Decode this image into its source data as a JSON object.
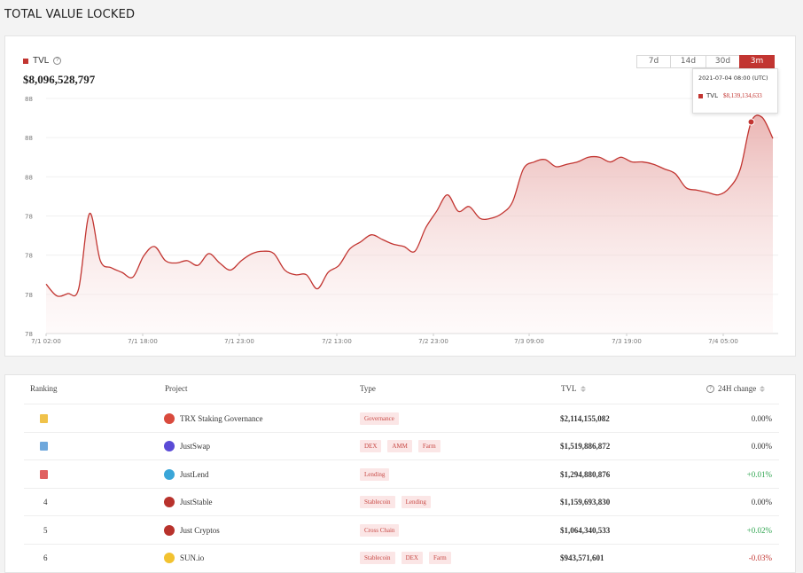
{
  "page_title": "TOTAL VALUE LOCKED",
  "chart_card": {
    "legend_label": "TVL",
    "current_value": "$8,096,528,797",
    "range_tabs": [
      "7d",
      "14d",
      "30d",
      "3m"
    ],
    "active_tab": "3m",
    "tooltip": {
      "date": "2021-07-04 08:00 (UTC)",
      "series_label": "TVL",
      "value": "$8,139,134,633"
    }
  },
  "chart_data": {
    "type": "area",
    "title": "",
    "xlabel": "",
    "ylabel": "",
    "y_tick_labels": [
      "88",
      "88",
      "88",
      "78",
      "78",
      "78",
      "78"
    ],
    "x_tick_labels": [
      "7/1 02:00",
      "7/1 18:00",
      "7/1 23:00",
      "7/2 13:00",
      "7/2 23:00",
      "7/3 09:00",
      "7/3 19:00",
      "7/4 05:00"
    ],
    "grid": true,
    "series": [
      {
        "name": "TVL",
        "color": "#c23531",
        "values": [
          0.21,
          0.16,
          0.17,
          0.19,
          0.51,
          0.31,
          0.28,
          0.26,
          0.24,
          0.33,
          0.37,
          0.31,
          0.3,
          0.31,
          0.29,
          0.34,
          0.3,
          0.27,
          0.31,
          0.34,
          0.35,
          0.34,
          0.27,
          0.25,
          0.25,
          0.19,
          0.26,
          0.29,
          0.36,
          0.39,
          0.42,
          0.4,
          0.38,
          0.37,
          0.35,
          0.45,
          0.52,
          0.59,
          0.52,
          0.54,
          0.49,
          0.49,
          0.51,
          0.56,
          0.7,
          0.73,
          0.74,
          0.71,
          0.72,
          0.73,
          0.75,
          0.75,
          0.73,
          0.75,
          0.73,
          0.73,
          0.72,
          0.7,
          0.68,
          0.62,
          0.61,
          0.6,
          0.59,
          0.62,
          0.7,
          0.9,
          0.92,
          0.83
        ]
      }
    ]
  },
  "table": {
    "headers": {
      "ranking": "Ranking",
      "project": "Project",
      "type": "Type",
      "tvl": "TVL",
      "change": "24H change"
    },
    "rows": [
      {
        "rank": "1",
        "medal": "gold",
        "project": "TRX Staking Governance",
        "icon": "trx-icon",
        "icon_color": "#d94a3d",
        "tags": [
          "Governance"
        ],
        "tvl": "$2,114,155,082",
        "change": "0.00%",
        "trend": "flat"
      },
      {
        "rank": "2",
        "medal": "blue",
        "project": "JustSwap",
        "icon": "justswap-icon",
        "icon_color": "#5a4bd6",
        "tags": [
          "DEX",
          "AMM",
          "Farm"
        ],
        "tvl": "$1,519,886,872",
        "change": "0.00%",
        "trend": "flat"
      },
      {
        "rank": "3",
        "medal": "red",
        "project": "JustLend",
        "icon": "justlend-icon",
        "icon_color": "#3aa6d8",
        "tags": [
          "Lending"
        ],
        "tvl": "$1,294,880,876",
        "change": "+0.01%",
        "trend": "up"
      },
      {
        "rank": "4",
        "medal": "",
        "project": "JustStable",
        "icon": "juststable-icon",
        "icon_color": "#b8322c",
        "tags": [
          "Stablecoin",
          "Lending"
        ],
        "tvl": "$1,159,693,830",
        "change": "0.00%",
        "trend": "flat"
      },
      {
        "rank": "5",
        "medal": "",
        "project": "Just Cryptos",
        "icon": "justcryptos-icon",
        "icon_color": "#b8322c",
        "tags": [
          "Cross Chain"
        ],
        "tvl": "$1,064,340,533",
        "change": "+0.02%",
        "trend": "up"
      },
      {
        "rank": "6",
        "medal": "",
        "project": "SUN.io",
        "icon": "sun-icon",
        "icon_color": "#f2c230",
        "tags": [
          "Stablecoin",
          "DEX",
          "Farm"
        ],
        "tvl": "$943,571,601",
        "change": "-0.03%",
        "trend": "down"
      }
    ]
  }
}
